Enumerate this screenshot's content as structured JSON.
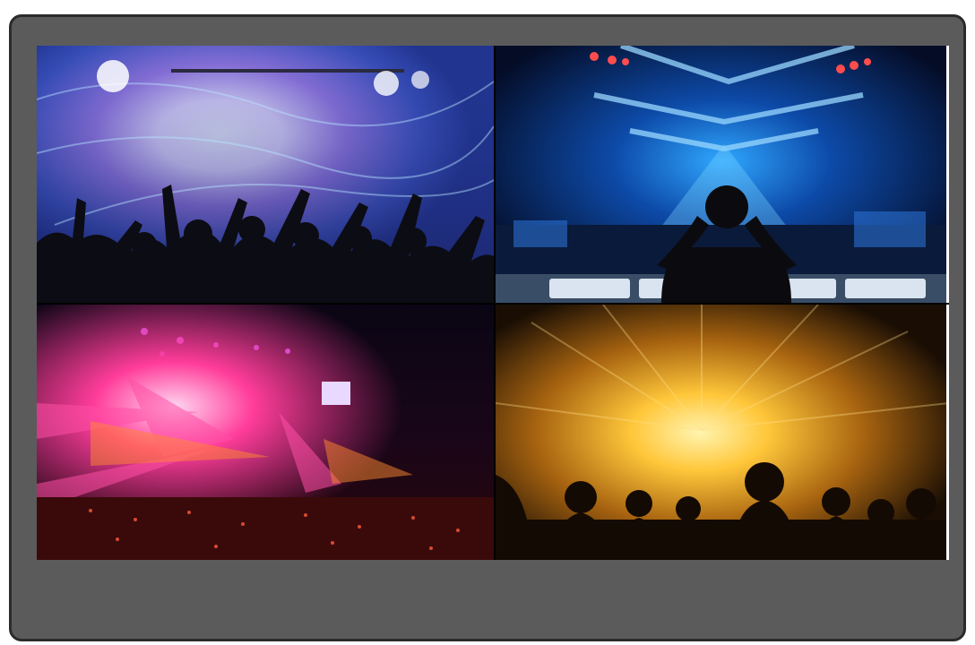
{
  "display": {
    "frame_color": "#5b5b5b",
    "border_color": "#2b2b2b"
  },
  "tiles": [
    {
      "id": "concert-crowd-blue-lights",
      "palette": [
        "#2a3f9e",
        "#8a5bd6",
        "#ffffff",
        "#0b0b12"
      ]
    },
    {
      "id": "dj-blue-club",
      "palette": [
        "#06163a",
        "#1f7fe0",
        "#7fd6ff",
        "#0a0a0a"
      ]
    },
    {
      "id": "arena-pink-lasers",
      "palette": [
        "#0a0510",
        "#ff2e7a",
        "#c44bff",
        "#ff8a2e"
      ]
    },
    {
      "id": "golden-stage-crowd",
      "palette": [
        "#1a0e04",
        "#ffb21a",
        "#fff1a0",
        "#0d0804"
      ]
    }
  ]
}
